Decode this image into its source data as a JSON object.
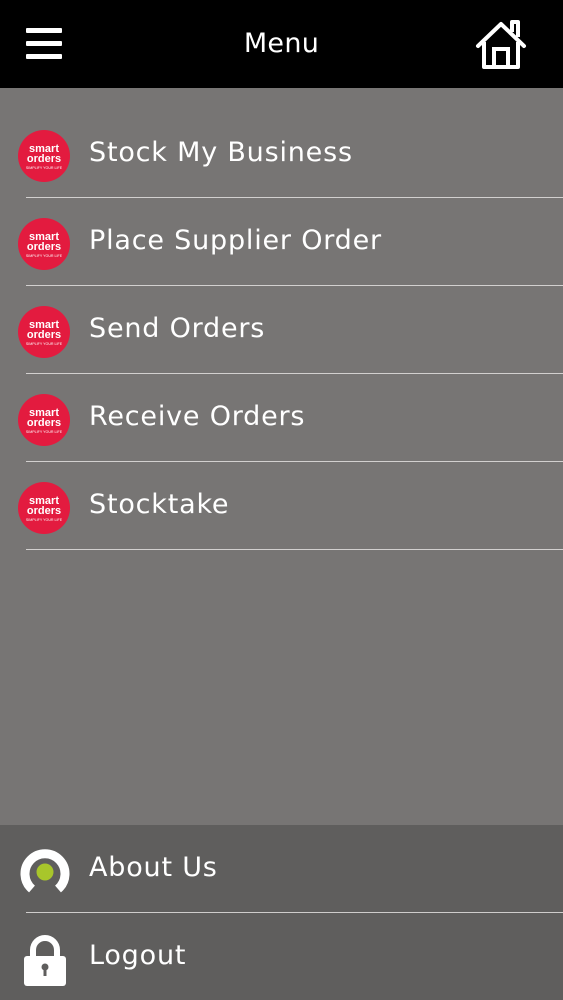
{
  "header": {
    "title": "Menu",
    "menu_icon": "hamburger-icon",
    "home_icon": "home-icon"
  },
  "brand": {
    "logo_line1": "smart",
    "logo_line2": "orders",
    "logo_tagline": "SIMPLIFY YOUR LIFE",
    "logo_color": "#e31b3f"
  },
  "menu": {
    "items": [
      {
        "label": "Stock My Business",
        "icon": "smart-orders-logo-icon"
      },
      {
        "label": "Place Supplier Order",
        "icon": "smart-orders-logo-icon"
      },
      {
        "label": "Send Orders",
        "icon": "smart-orders-logo-icon"
      },
      {
        "label": "Receive Orders",
        "icon": "smart-orders-logo-icon"
      },
      {
        "label": "Stocktake",
        "icon": "smart-orders-logo-icon"
      }
    ]
  },
  "bottom": {
    "items": [
      {
        "label": "About Us",
        "icon": "about-ring-icon"
      },
      {
        "label": "Logout",
        "icon": "padlock-icon"
      }
    ]
  },
  "colors": {
    "header_bg": "#000000",
    "menu_bg": "#777574",
    "bottom_bg": "#5f5e5d",
    "text": "#ffffff",
    "accent_green": "#a8c62b"
  }
}
